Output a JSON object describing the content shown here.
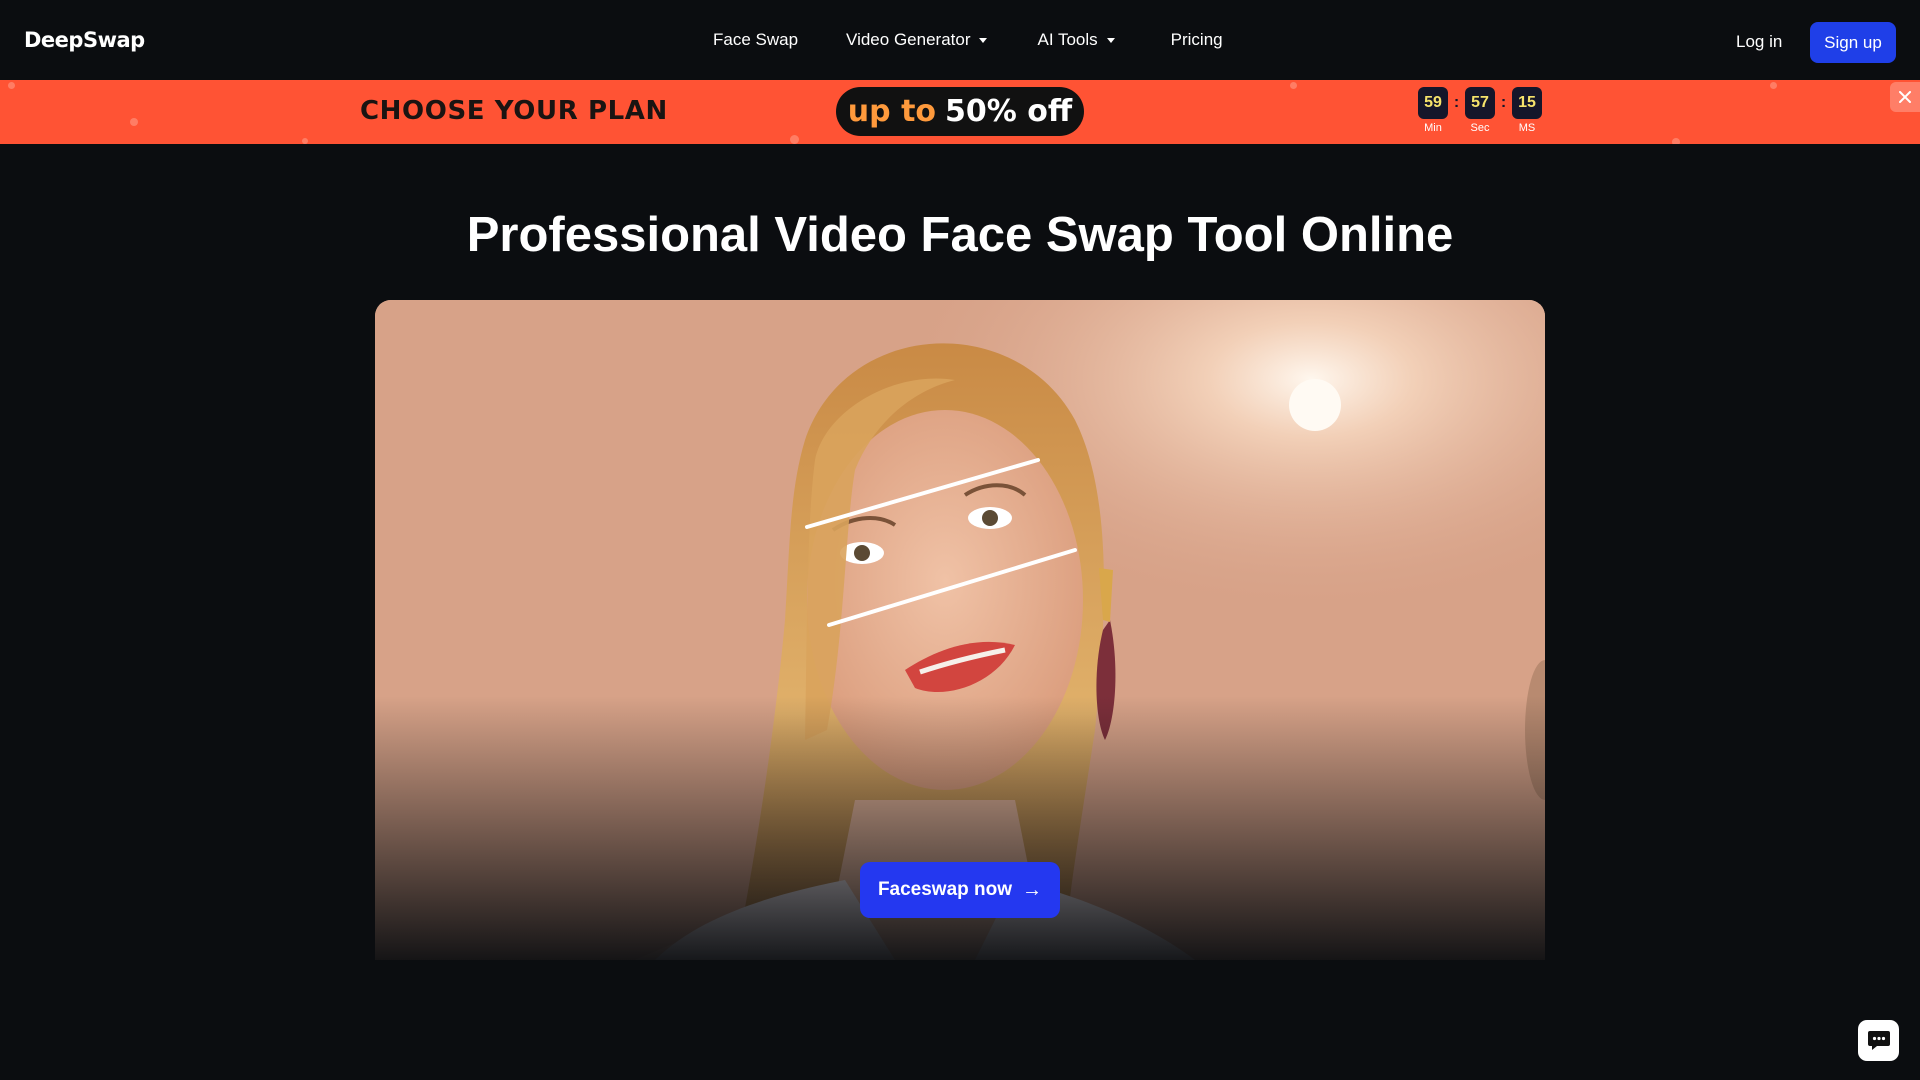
{
  "nav": {
    "logo": "DeepSwap",
    "links": [
      {
        "label": "Face Swap",
        "has_dropdown": false
      },
      {
        "label": "Video Generator",
        "has_dropdown": true
      },
      {
        "label": "AI Tools",
        "has_dropdown": true
      },
      {
        "label": "Pricing",
        "has_dropdown": false
      }
    ],
    "login": "Log in",
    "signup": "Sign up"
  },
  "banner": {
    "title": "CHOOSE YOUR PLAN",
    "discount_lead": "up to",
    "discount_amount": "50% off",
    "countdown": [
      {
        "value": "59",
        "label": "Min"
      },
      {
        "value": "57",
        "label": "Sec"
      },
      {
        "value": "15",
        "label": "MS"
      }
    ],
    "separator": ":",
    "close_icon": "close-icon"
  },
  "hero": {
    "title": "Professional Video Face Swap Tool Online",
    "cta": "Faceswap now",
    "cta_icon": "arrow-right-icon"
  },
  "colors": {
    "background": "#0b0d10",
    "banner": "#ff5334",
    "primary": "#1f3fe8",
    "cta": "#2438f0",
    "countdown_digits": "#f6e36b"
  },
  "chat": {
    "icon": "chat-icon"
  }
}
